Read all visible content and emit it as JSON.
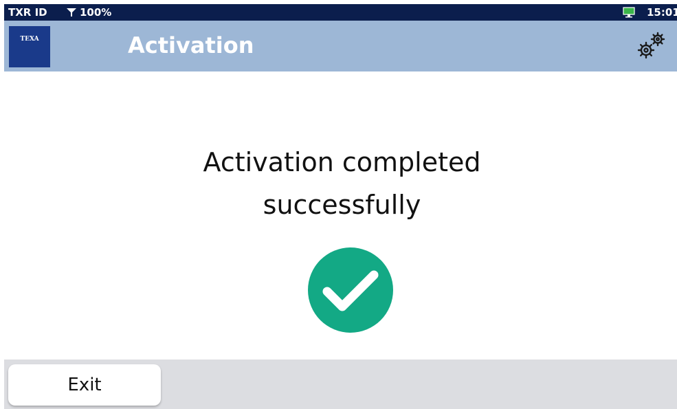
{
  "status_bar": {
    "device_id": "TXR ID",
    "signal": "100%",
    "time": "15:01",
    "icons": [
      "filter-signal-icon",
      "monitor-icon"
    ]
  },
  "header": {
    "logo_text": "TEXA",
    "title": "Activation",
    "settings_icon": "gears-icon"
  },
  "main": {
    "message_line1": "Activation completed",
    "message_line2": "successfully",
    "success_icon": "check-circle-icon",
    "success_color": "#13a985"
  },
  "footer": {
    "exit_label": "Exit"
  }
}
